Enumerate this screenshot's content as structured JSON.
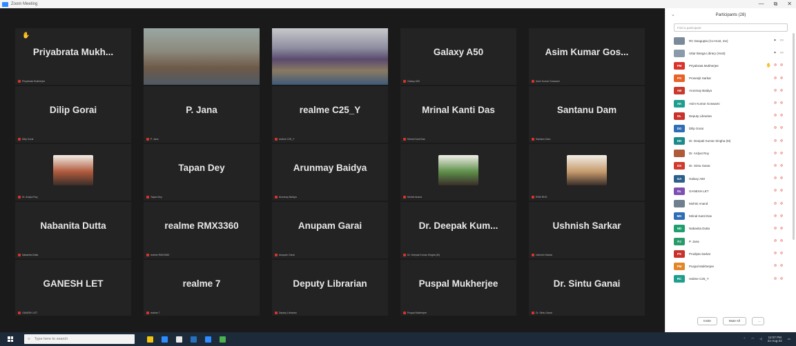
{
  "window": {
    "title": "Zoom Meeting"
  },
  "tiles": [
    {
      "display": "Priyabrata Mukh...",
      "caption": "Priyabrata Mukherjee",
      "hand": true
    },
    {
      "video": true,
      "active": true,
      "caption": ""
    },
    {
      "video": true,
      "active": false,
      "caption": ""
    },
    {
      "display": "Galaxy A50",
      "caption": "Galaxy A50"
    },
    {
      "display": "Asim Kumar Gos...",
      "caption": "Asim Kumar Goswami"
    },
    {
      "display": "Dilip Gorai",
      "caption": "Dilip Gorai"
    },
    {
      "display": "P. Jana",
      "caption": "P. Jana"
    },
    {
      "display": "realme C25_Y",
      "caption": "realme C25_Y"
    },
    {
      "display": "Mrinal Kanti Das",
      "caption": "Mrinal Kanti Das"
    },
    {
      "display": "Santanu Dam",
      "caption": "Santanu Dam"
    },
    {
      "photo": "#b05a3c",
      "caption": "Dr. Ardyut Roy"
    },
    {
      "display": "Tapan Dey",
      "caption": "Tapan Dey"
    },
    {
      "display": "Arunmay Baidya",
      "caption": "Arunmay Baidya"
    },
    {
      "photo": "#5e8f4a",
      "caption": "Mohini Anand"
    },
    {
      "photo": "#c69a6c",
      "caption": "RSM RDG"
    },
    {
      "display": "Nabanita Dutta",
      "caption": "Nabanita Dutta"
    },
    {
      "display": "realme RMX3360",
      "caption": "realme RMX3360"
    },
    {
      "display": "Anupam Garai",
      "caption": "Anupam Garai"
    },
    {
      "display": "Dr. Deepak Kum...",
      "caption": "Dr. Deepak Kumar Singha (M)"
    },
    {
      "display": "Ushnish Sarkar",
      "caption": "Ushnish Sarkar"
    },
    {
      "display": "GANESH LET",
      "caption": "GANESH LET"
    },
    {
      "display": "realme 7",
      "caption": "realme 7"
    },
    {
      "display": "Deputy Librarian",
      "caption": "Deputy Librarian"
    },
    {
      "display": "Puspal Mukherjee",
      "caption": "Puspal Mukherjee"
    },
    {
      "display": "Dr. Sintu Ganai",
      "caption": "Dr. Sintu Ganai"
    }
  ],
  "panel": {
    "title": "Participants (28)",
    "search_placeholder": "Find a participant",
    "participants": [
      {
        "initials": "",
        "color": "#7a8a9a",
        "name": "RC Dasgupta (Co-Host, me)",
        "mic": "on",
        "cam": "on"
      },
      {
        "initials": "",
        "color": "#8a9aa8",
        "name": "Uttar Banga Library (Host)",
        "mic": "on",
        "cam": "on"
      },
      {
        "initials": "PM",
        "color": "#d9342b",
        "name": "Priyabrata Mukherjee",
        "hand": true
      },
      {
        "initials": "PS",
        "color": "#e8622a",
        "name": "Prosenjit Sarkar"
      },
      {
        "initials": "AB",
        "color": "#c93a2e",
        "name": "Arunmay Baidya"
      },
      {
        "initials": "AK",
        "color": "#1f9e8e",
        "name": "Asim Kumar Goswami"
      },
      {
        "initials": "DL",
        "color": "#c8322c",
        "name": "Deputy Librarian"
      },
      {
        "initials": "DG",
        "color": "#2f6db5",
        "name": "Dilip Gorai"
      },
      {
        "initials": "DD",
        "color": "#1c8a8a",
        "name": "Dr. Deepak Kumar Singha (M)"
      },
      {
        "initials": "",
        "color": "#b05a3c",
        "name": "Dr. Ardyut Roy"
      },
      {
        "initials": "DS",
        "color": "#d03a30",
        "name": "Dr. Sintu Ganai"
      },
      {
        "initials": "GA",
        "color": "#2c5f8c",
        "name": "Galaxy A50"
      },
      {
        "initials": "GL",
        "color": "#7d4fb3",
        "name": "GANESH LET"
      },
      {
        "initials": "",
        "color": "#6e7f8e",
        "name": "Mohini Anand"
      },
      {
        "initials": "MK",
        "color": "#2f6db5",
        "name": "Mrinal Kanti Das"
      },
      {
        "initials": "ND",
        "color": "#1f9e70",
        "name": "Nabanita Dutta"
      },
      {
        "initials": "PJ",
        "color": "#2a9a6a",
        "name": "P. Jana"
      },
      {
        "initials": "PS",
        "color": "#c8322c",
        "name": "Prodipta Sarkar"
      },
      {
        "initials": "PM",
        "color": "#e2862a",
        "name": "Puspal Mukherjee"
      },
      {
        "initials": "RC",
        "color": "#1f9e8e",
        "name": "realme C25_Y"
      }
    ],
    "invite_label": "Invite",
    "mute_all_label": "Mute All",
    "more_label": "..."
  },
  "taskbar": {
    "search_placeholder": "Type here to search",
    "time": "12:07 PM",
    "date": "21-Aug-22",
    "apps": [
      "#f1c40f",
      "#2d8cff",
      "#e9e9e9",
      "#2671be",
      "#2d8cff",
      "#4caf50"
    ]
  }
}
